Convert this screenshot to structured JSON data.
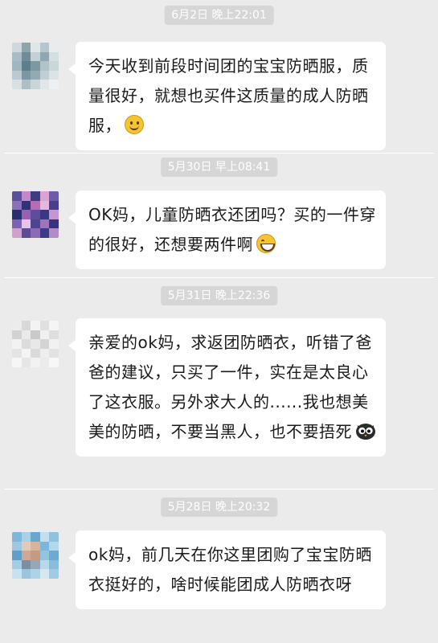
{
  "chat": {
    "messages": [
      {
        "timestamp": "6月2日 晚上22:01",
        "text": "今天收到前段时间团的宝宝防晒服，质量很好，就想也买件这质量的成人防晒服，",
        "emoji": "smile-emoji"
      },
      {
        "timestamp": "5月30日 早上08:41",
        "text": "OK妈，儿童防晒衣还团吗？买的一件穿的很好，还想要两件啊",
        "emoji": "grin-emoji"
      },
      {
        "timestamp": "5月31日 晚上22:36",
        "text": "亲爱的ok妈，求返团防晒衣，听错了爸爸的建议，只买了一件，实在是太良心了这衣服。另外求大人的......我也想美美的防晒，不要当黑人，也不要捂死",
        "emoji": "owl-emoji"
      },
      {
        "timestamp": "5月28日 晚上20:32",
        "text": "ok妈，前几天在你这里团购了宝宝防晒衣挺好的，啥时候能团成人防晒衣呀",
        "emoji": ""
      }
    ]
  },
  "colors": {
    "background": "#ebebeb",
    "bubble": "#ffffff",
    "timestamp_bg": "#d6d6d6",
    "timestamp_text": "#ffffff",
    "message_text": "#1a1a1a"
  }
}
